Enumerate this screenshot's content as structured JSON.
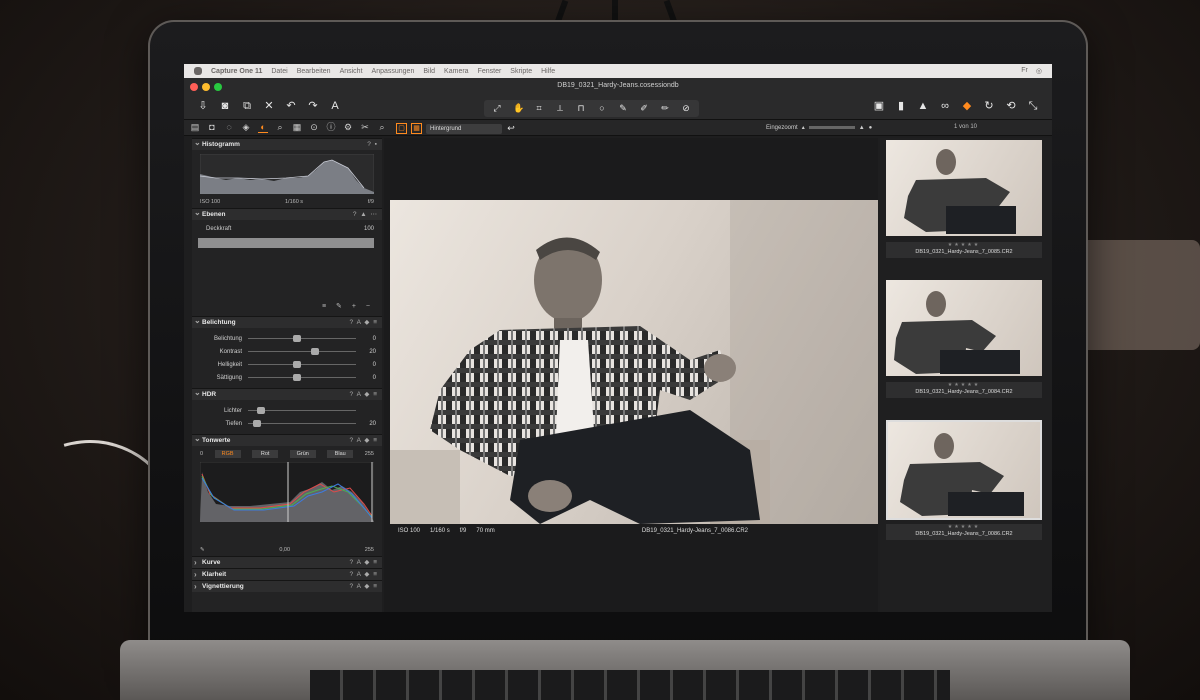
{
  "menubar": {
    "app_name": "Capture One 11",
    "items": [
      "Datei",
      "Bearbeiten",
      "Ansicht",
      "Anpassungen",
      "Bild",
      "Kamera",
      "Fenster",
      "Skripte",
      "Hilfe"
    ],
    "clock": "Fr"
  },
  "toolbar": {
    "document_title": "DB19_0321_Hardy-Jeans.cosessiondb",
    "left_icons": [
      "import-icon",
      "camera-icon",
      "copy-icon",
      "delete-icon",
      "undo-icon",
      "redo-icon",
      "text-icon"
    ],
    "cursor_tools": [
      "pan-icon",
      "hand-icon",
      "crop-icon",
      "straighten-icon",
      "keystone-icon",
      "spot-icon",
      "brush-icon",
      "eraser-icon",
      "gradient-icon",
      "picker-icon"
    ],
    "right_icons": [
      "edit-icon",
      "flag-icon",
      "warning-icon",
      "proof-icon",
      "stack-icon",
      "rotate-icon",
      "sync-icon",
      "expand-icon"
    ]
  },
  "subbar": {
    "view_select": "Hintergrund",
    "zoom_label": "Eingezoomt",
    "counter": "1 von 10"
  },
  "left_panel": {
    "histogram": {
      "title": "Histogramm",
      "iso": "ISO 100",
      "shutter": "1/160 s",
      "aperture": "f/9"
    },
    "layers": {
      "title": "Ebenen",
      "opacity_label": "Deckkraft",
      "opacity_value": "100"
    },
    "exposure": {
      "title": "Belichtung",
      "rows": [
        {
          "label": "Belichtung",
          "value": "0",
          "pos": 0.42
        },
        {
          "label": "Kontrast",
          "value": "20",
          "pos": 0.58
        },
        {
          "label": "Helligkeit",
          "value": "0",
          "pos": 0.42
        },
        {
          "label": "Sättigung",
          "value": "0",
          "pos": 0.42
        }
      ]
    },
    "hdr": {
      "title": "HDR",
      "rows": [
        {
          "label": "Lichter",
          "value": "",
          "pos": 0.08
        },
        {
          "label": "Tiefen",
          "value": "20",
          "pos": 0.05
        }
      ]
    },
    "levels": {
      "title": "Tonwerte",
      "min": "0",
      "max": "255",
      "channels": [
        "RGB",
        "Rot",
        "Grün",
        "Blau"
      ],
      "midpoint": "0,00",
      "out_max": "255"
    },
    "collapsed": [
      {
        "title": "Kurve"
      },
      {
        "title": "Klarheit"
      },
      {
        "title": "Vignettierung"
      }
    ]
  },
  "viewer": {
    "iso": "ISO 100",
    "shutter": "1/160 s",
    "aperture": "f/9",
    "focal": "70 mm",
    "filename": "DB19_0321_Hardy-Jeans_7_0086.CR2"
  },
  "filmstrip": [
    {
      "label": "DB19_0321_Hardy-Jeans_7_0085.CR2",
      "selected": false
    },
    {
      "label": "DB19_0321_Hardy-Jeans_7_0084.CR2",
      "selected": false
    },
    {
      "label": "DB19_0321_Hardy-Jeans_7_0086.CR2",
      "selected": true
    }
  ],
  "colors": {
    "accent": "#ff8a1e",
    "panel": "#232324",
    "viewer_bg": "#1b1b1c"
  }
}
